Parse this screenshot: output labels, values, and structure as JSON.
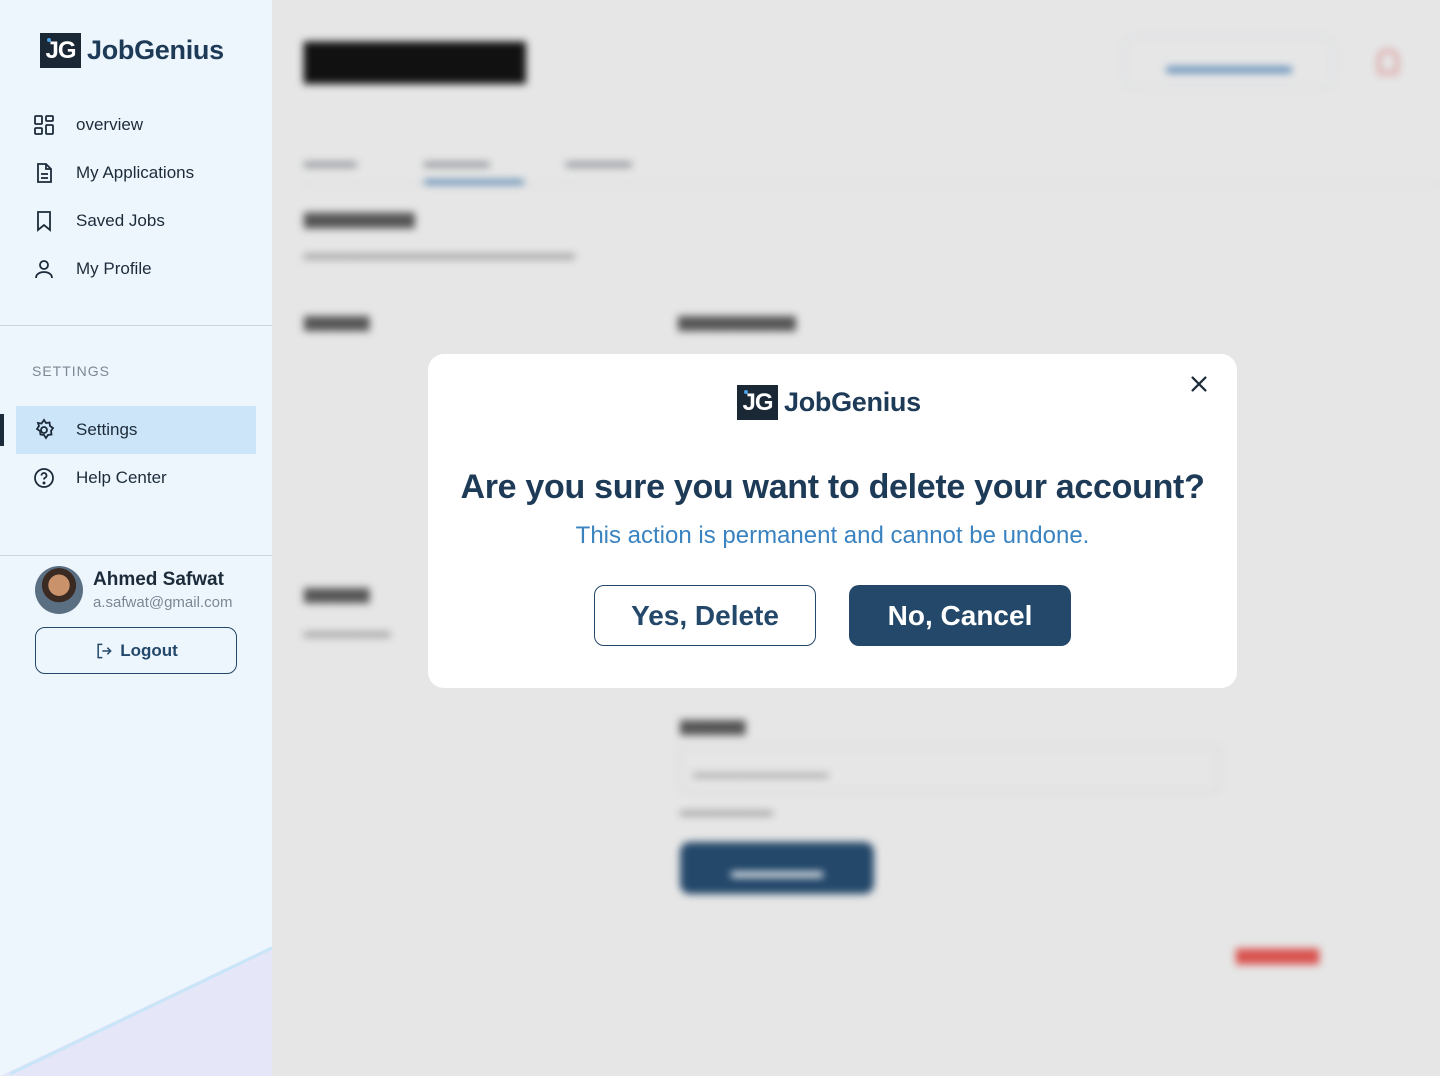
{
  "brand": {
    "logo_text": "JG",
    "name": "JobGenius"
  },
  "sidebar": {
    "nav_items": [
      {
        "label": "overview",
        "icon": "grid-icon"
      },
      {
        "label": "My Applications",
        "icon": "document-icon"
      },
      {
        "label": "Saved Jobs",
        "icon": "bookmark-icon"
      },
      {
        "label": "My Profile",
        "icon": "user-icon"
      }
    ],
    "settings_section_label": "SETTINGS",
    "settings_items": [
      {
        "label": "Settings",
        "icon": "gear-icon",
        "active": true
      },
      {
        "label": "Help Center",
        "icon": "help-circle-icon",
        "active": false
      }
    ],
    "user": {
      "name": "Ahmed Safwat",
      "email": "a.safwat@gmail.com"
    },
    "logout_label": "Logout"
  },
  "modal": {
    "title": "Are you sure you want to delete your account?",
    "subtitle": "This action is permanent and cannot be undone.",
    "confirm_label": "Yes, Delete",
    "cancel_label": "No, Cancel"
  },
  "colors": {
    "primary": "#24486a",
    "accent_text": "#3a83c0",
    "sidebar_bg": "#eef6fd",
    "active_item_bg": "#cde5f8",
    "overlay_bg": "#e6e6e6"
  }
}
